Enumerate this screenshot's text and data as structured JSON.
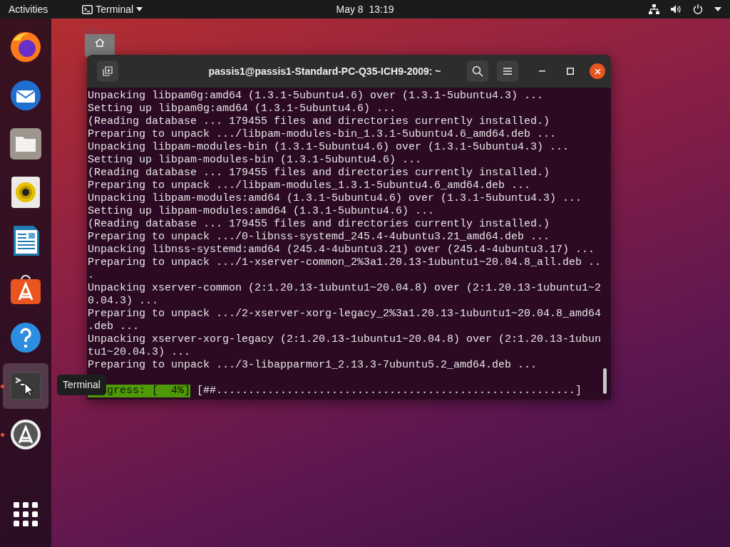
{
  "top_bar": {
    "activities": "Activities",
    "app_menu": "Terminal",
    "clock": "May 8  13:19"
  },
  "dock": [
    {
      "kind": "firefox",
      "running": false,
      "selected": false
    },
    {
      "kind": "thunderbird",
      "running": false,
      "selected": false
    },
    {
      "kind": "files",
      "running": false,
      "selected": false
    },
    {
      "kind": "rhythmbox",
      "running": false,
      "selected": false
    },
    {
      "kind": "writer",
      "running": false,
      "selected": false
    },
    {
      "kind": "software",
      "running": false,
      "selected": false
    },
    {
      "kind": "help",
      "running": false,
      "selected": false
    },
    {
      "kind": "terminal",
      "running": true,
      "selected": true
    },
    {
      "kind": "updater",
      "running": true,
      "selected": false
    },
    {
      "kind": "apps",
      "running": false,
      "selected": false
    }
  ],
  "tooltip": "Terminal",
  "desktop_icons": [
    {
      "kind": "home"
    }
  ],
  "terminal": {
    "title": "passis1@passis1-Standard-PC-Q35-ICH9-2009: ~",
    "lines": [
      "Unpacking libpam0g:amd64 (1.3.1-5ubuntu4.6) over (1.3.1-5ubuntu4.3) ...",
      "Setting up libpam0g:amd64 (1.3.1-5ubuntu4.6) ...",
      "(Reading database ... 179455 files and directories currently installed.)",
      "Preparing to unpack .../libpam-modules-bin_1.3.1-5ubuntu4.6_amd64.deb ...",
      "Unpacking libpam-modules-bin (1.3.1-5ubuntu4.6) over (1.3.1-5ubuntu4.3) ...",
      "Setting up libpam-modules-bin (1.3.1-5ubuntu4.6) ...",
      "(Reading database ... 179455 files and directories currently installed.)",
      "Preparing to unpack .../libpam-modules_1.3.1-5ubuntu4.6_amd64.deb ...",
      "Unpacking libpam-modules:amd64 (1.3.1-5ubuntu4.6) over (1.3.1-5ubuntu4.3) ...",
      "Setting up libpam-modules:amd64 (1.3.1-5ubuntu4.6) ...",
      "(Reading database ... 179455 files and directories currently installed.)",
      "Preparing to unpack .../0-libnss-systemd_245.4-4ubuntu3.21_amd64.deb ...",
      "Unpacking libnss-systemd:amd64 (245.4-4ubuntu3.21) over (245.4-4ubuntu3.17) ...",
      "Preparing to unpack .../1-xserver-common_2%3a1.20.13-1ubuntu1~20.04.8_all.deb ..",
      ".",
      "Unpacking xserver-common (2:1.20.13-1ubuntu1~20.04.8) over (2:1.20.13-1ubuntu1~2",
      "0.04.3) ...",
      "Preparing to unpack .../2-xserver-xorg-legacy_2%3a1.20.13-1ubuntu1~20.04.8_amd64",
      ".deb ...",
      "Unpacking xserver-xorg-legacy (2:1.20.13-1ubuntu1~20.04.8) over (2:1.20.13-1ubun",
      "tu1~20.04.3) ...",
      "Preparing to unpack .../3-libapparmor1_2.13.3-7ubuntu5.2_amd64.deb ..."
    ],
    "progress": {
      "label": "gress: [  4%]",
      "bar": "[##........................................................]"
    }
  }
}
